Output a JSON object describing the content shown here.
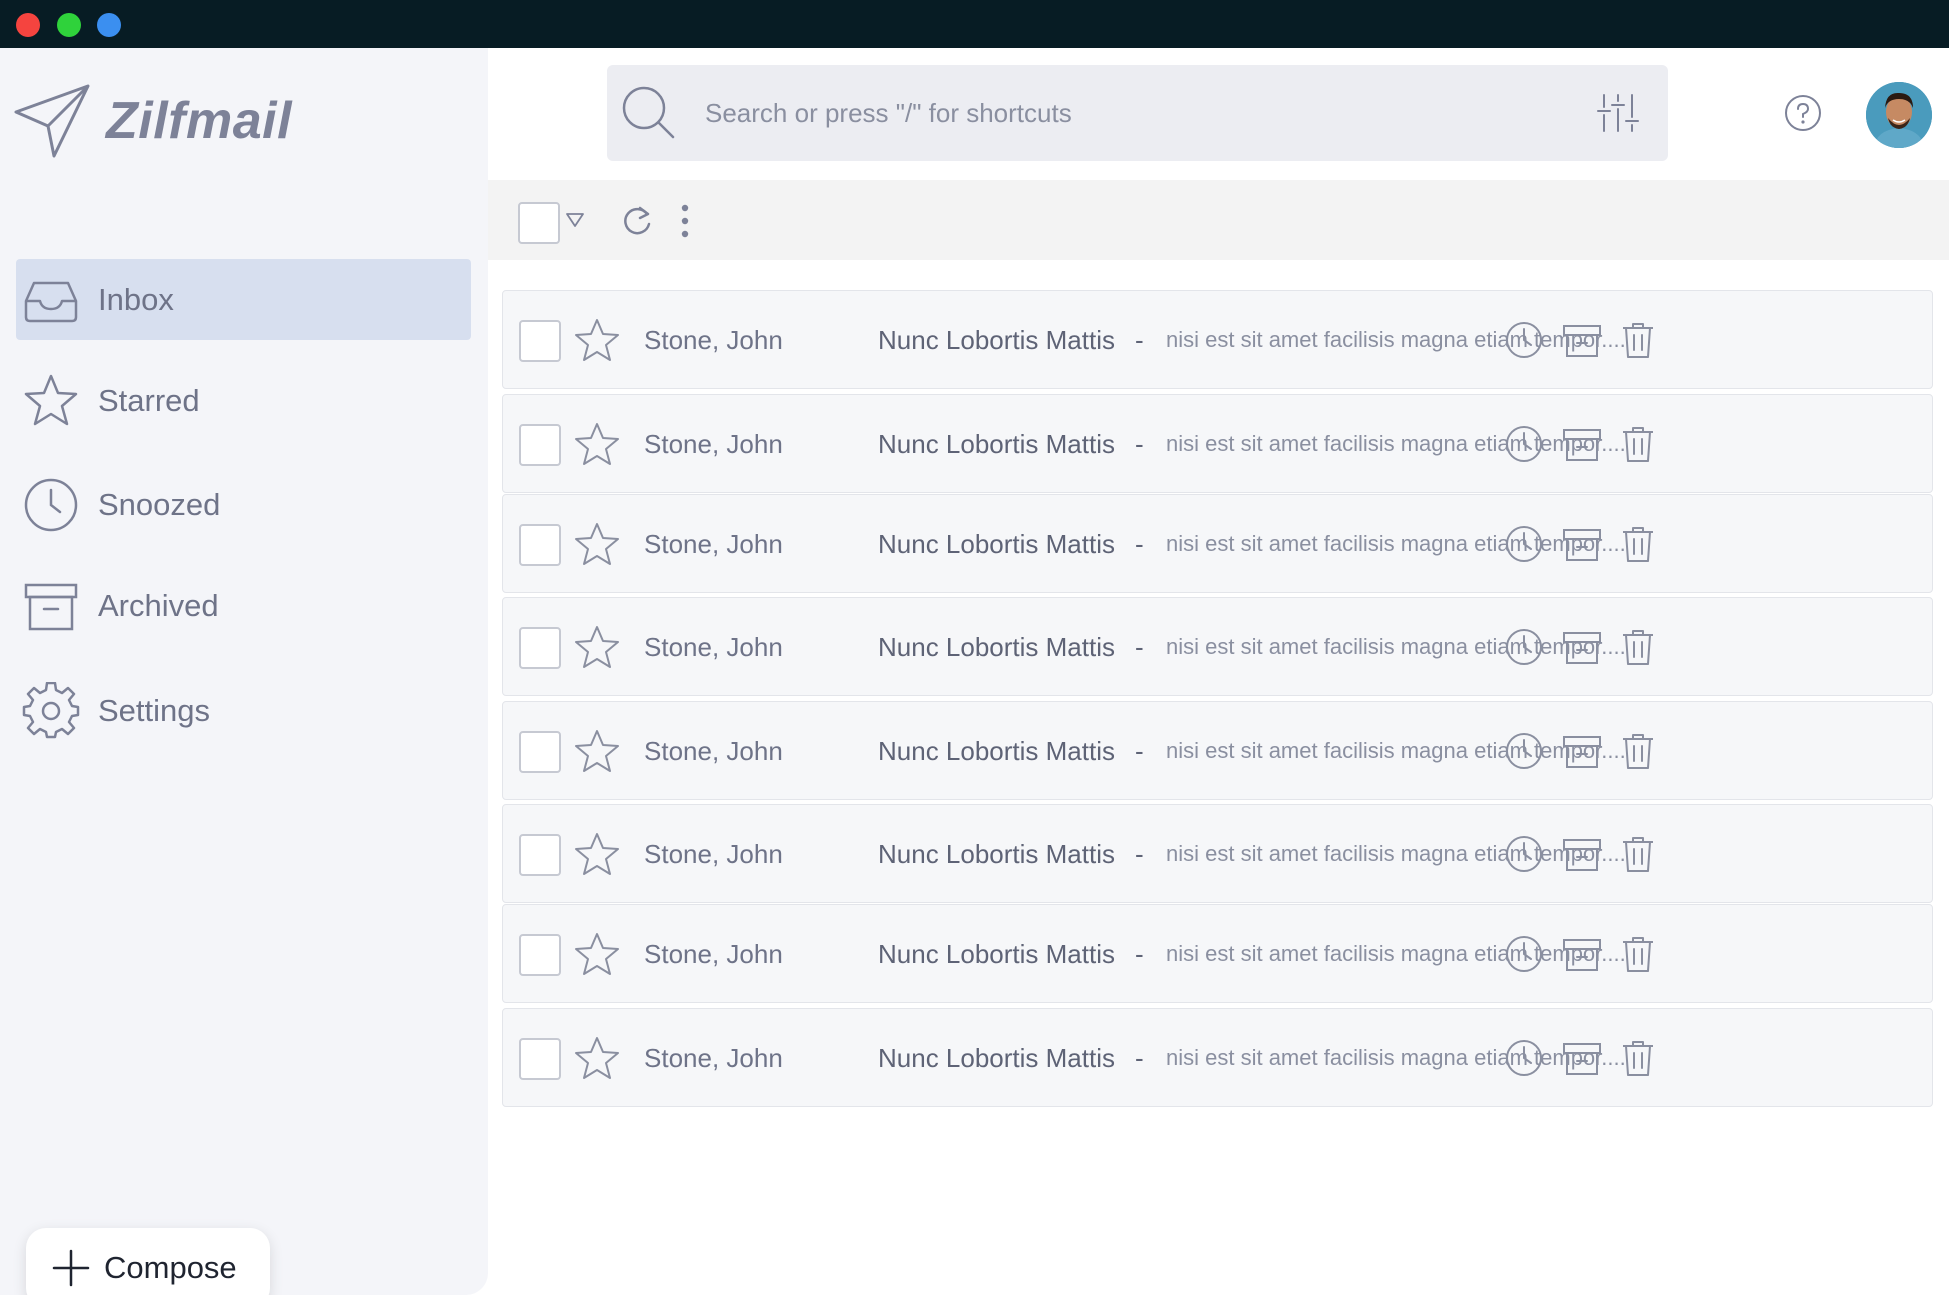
{
  "app": {
    "name": "Zilfmail"
  },
  "sidebar": {
    "items": [
      {
        "label": "Inbox",
        "icon": "inbox-icon",
        "active": true
      },
      {
        "label": "Starred",
        "icon": "star-icon",
        "active": false
      },
      {
        "label": "Snoozed",
        "icon": "clock-icon",
        "active": false
      },
      {
        "label": "Archived",
        "icon": "archive-icon",
        "active": false
      },
      {
        "label": "Settings",
        "icon": "gear-icon",
        "active": false
      }
    ],
    "compose_label": "Compose"
  },
  "search": {
    "placeholder": "Search or press \"/\" for shortcuts"
  },
  "emails": [
    {
      "sender": "Stone, John",
      "subject": "Nunc Lobortis Mattis",
      "separator": "-",
      "snippet": "nisi est sit amet facilisis magna etiam tempor...."
    },
    {
      "sender": "Stone, John",
      "subject": "Nunc Lobortis Mattis",
      "separator": "-",
      "snippet": "nisi est sit amet facilisis magna etiam tempor...."
    },
    {
      "sender": "Stone, John",
      "subject": "Nunc Lobortis Mattis",
      "separator": "-",
      "snippet": "nisi est sit amet facilisis magna etiam tempor...."
    },
    {
      "sender": "Stone, John",
      "subject": "Nunc Lobortis Mattis",
      "separator": "-",
      "snippet": "nisi est sit amet facilisis magna etiam tempor...."
    },
    {
      "sender": "Stone, John",
      "subject": "Nunc Lobortis Mattis",
      "separator": "-",
      "snippet": "nisi est sit amet facilisis magna etiam tempor...."
    },
    {
      "sender": "Stone, John",
      "subject": "Nunc Lobortis Mattis",
      "separator": "-",
      "snippet": "nisi est sit amet facilisis magna etiam tempor...."
    },
    {
      "sender": "Stone, John",
      "subject": "Nunc Lobortis Mattis",
      "separator": "-",
      "snippet": "nisi est sit amet facilisis magna etiam tempor...."
    },
    {
      "sender": "Stone, John",
      "subject": "Nunc Lobortis Mattis",
      "separator": "-",
      "snippet": "nisi est sit amet facilisis magna etiam tempor...."
    }
  ],
  "colors": {
    "titlebar": "#071c24",
    "sidebar_bg": "#f4f5f9",
    "active_nav_bg": "#d7dfef",
    "icon_gray": "#7d8298",
    "traffic_red": "#f5443f",
    "traffic_green": "#2fd23b",
    "traffic_blue": "#3b8ff0"
  }
}
